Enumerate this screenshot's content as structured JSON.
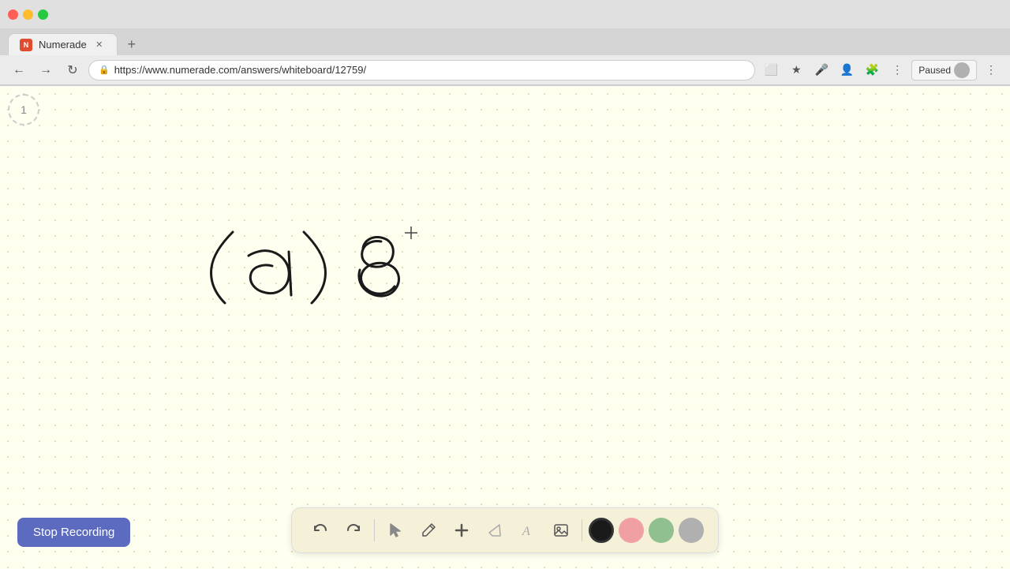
{
  "browser": {
    "tab_title": "Numerade",
    "tab_favicon": "N",
    "url": "https://www.numerade.com/answers/whiteboard/12759/",
    "paused_label": "Paused"
  },
  "page": {
    "page_number": "1",
    "cursor_visible": true
  },
  "toolbar": {
    "undo_label": "↺",
    "redo_label": "↻",
    "select_label": "▲",
    "pen_label": "✏",
    "add_label": "+",
    "eraser_label": "/",
    "text_label": "A",
    "image_label": "▦",
    "colors": [
      "#1a1a1a",
      "#f0a0a0",
      "#90c090",
      "#b0b0b0"
    ]
  },
  "stop_recording": {
    "label": "Stop Recording"
  }
}
